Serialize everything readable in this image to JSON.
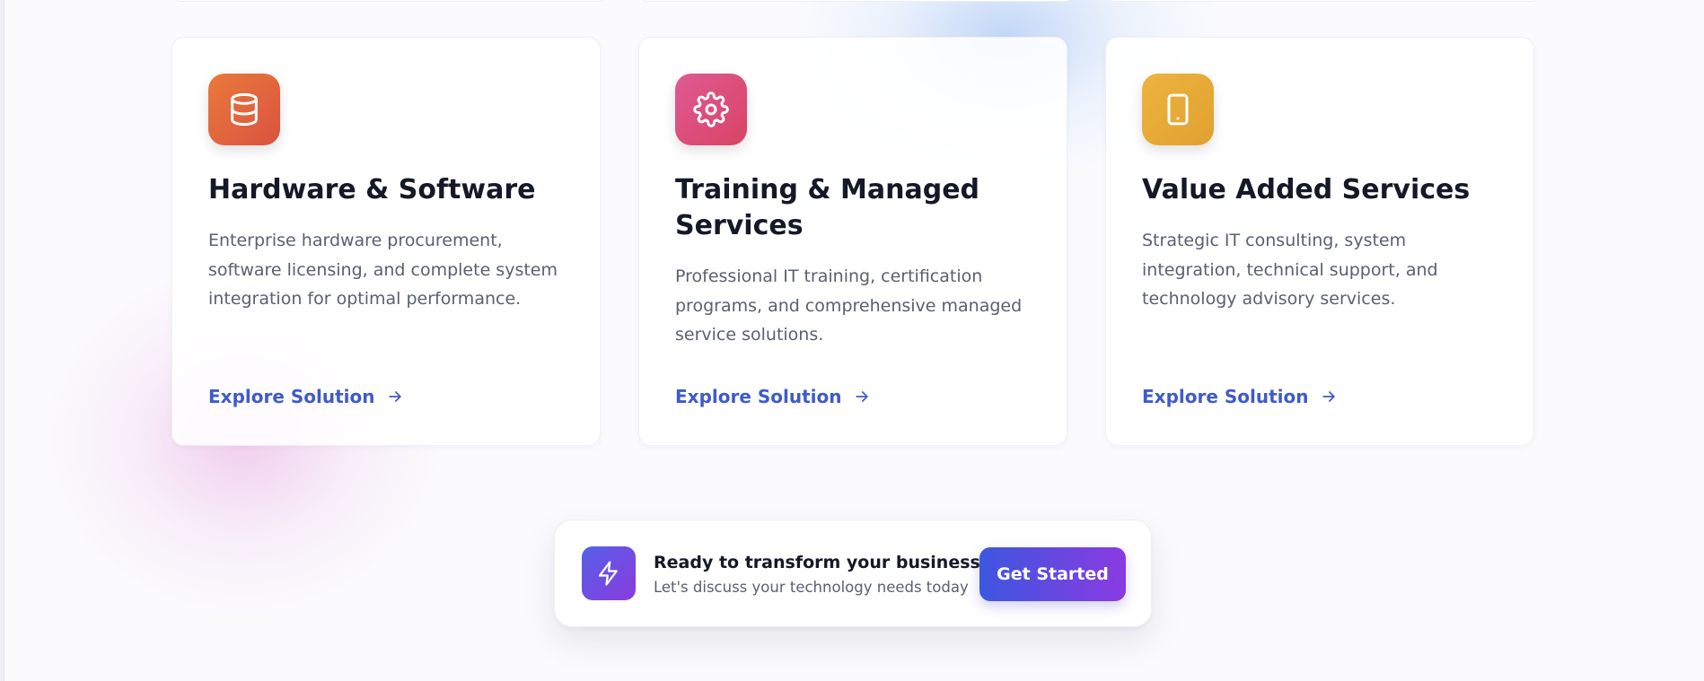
{
  "services": [
    {
      "icon": "database-icon",
      "icon_gradient": [
        "#ea7a3c",
        "#d9523f"
      ],
      "title": "Hardware & Software",
      "description": "Enterprise hardware procurement, software licensing, and complete system integration for optimal performance.",
      "link_label": "Explore Solution"
    },
    {
      "icon": "gear-icon",
      "icon_gradient": [
        "#e05a93",
        "#d84365"
      ],
      "title": "Training & Managed Services",
      "description": "Professional IT training, certification programs, and comprehensive managed service solutions.",
      "link_label": "Explore Solution"
    },
    {
      "icon": "tablet-icon",
      "icon_gradient": [
        "#edb43d",
        "#e0a032"
      ],
      "title": "Value Added Services",
      "description": "Strategic IT consulting, system integration, technical support, and technology advisory services.",
      "link_label": "Explore Solution"
    }
  ],
  "cta": {
    "icon": "lightning-icon",
    "title": "Ready to transform your business?",
    "subtitle": "Let's discuss your technology needs today",
    "button_label": "Get Started"
  },
  "colors": {
    "link": "#3f5bc7",
    "heading": "#141827",
    "body_text": "#5a6070",
    "cta_gradient": [
      "#3d57e0",
      "#8a3ae0"
    ]
  }
}
